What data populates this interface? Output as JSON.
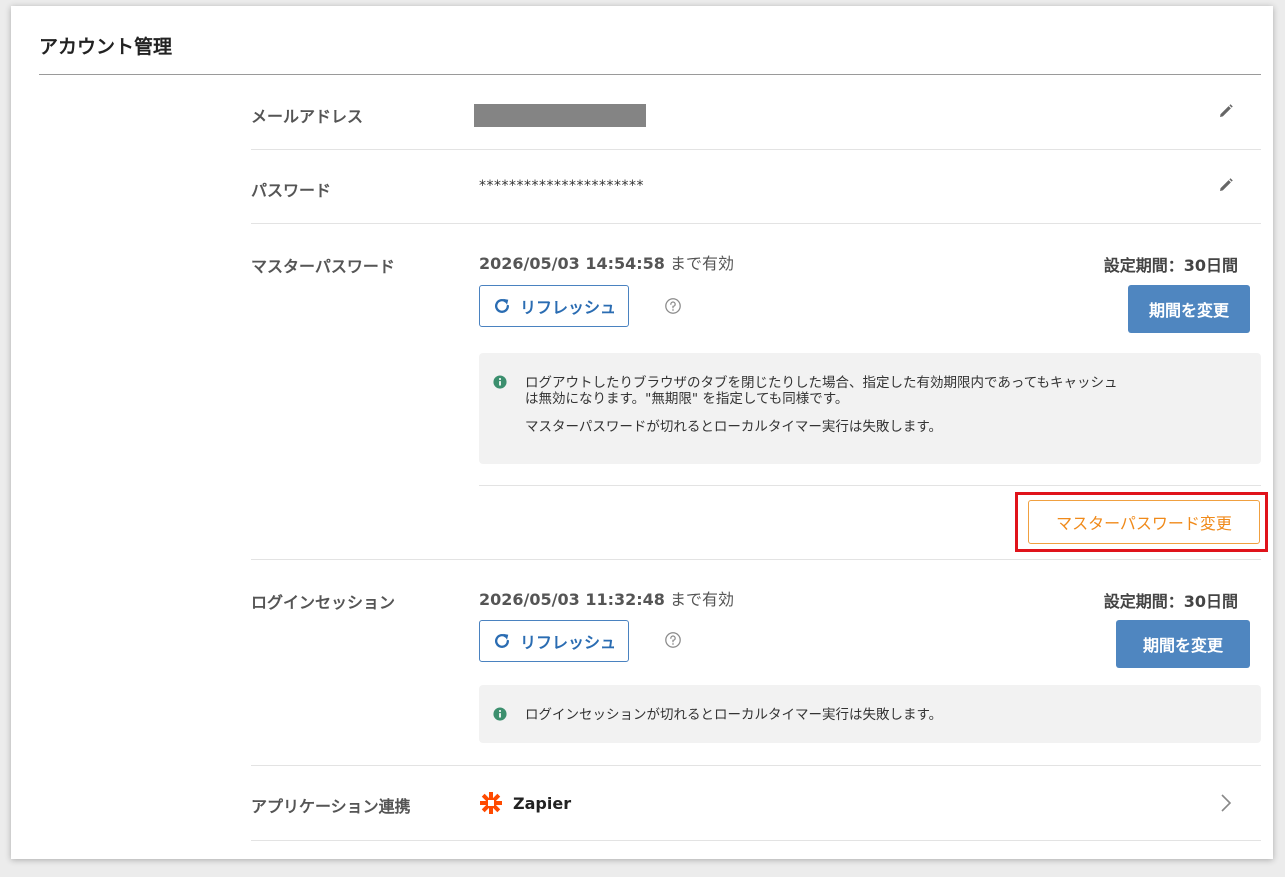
{
  "page": {
    "title": "アカウント管理"
  },
  "email": {
    "label": "メールアドレス"
  },
  "password": {
    "label": "パスワード",
    "value": "**********************"
  },
  "master_password": {
    "label": "マスターパスワード",
    "expiry_datetime": "2026/05/03 14:54:58",
    "expiry_suffix": " まで有効",
    "period": "設定期間：30日間",
    "refresh_label": "リフレッシュ",
    "change_period_label": "期間を変更",
    "info_line1": "ログアウトしたりブラウザのタブを閉じたりした場合、指定した有効期限内であってもキャッシュ",
    "info_line2": "は無効になります。\"無期限\" を指定しても同様です。",
    "info_line3": "マスターパスワードが切れるとローカルタイマー実行は失敗します。",
    "change_label": "マスターパスワード変更"
  },
  "login_session": {
    "label": "ログインセッション",
    "expiry_datetime": "2026/05/03 11:32:48",
    "expiry_suffix": " まで有効",
    "period": "設定期間：30日間",
    "refresh_label": "リフレッシュ",
    "change_period_label": "期間を変更",
    "info_line1": "ログインセッションが切れるとローカルタイマー実行は失敗します。"
  },
  "app_integration": {
    "label": "アプリケーション連携",
    "app_name": "Zapier"
  },
  "colors": {
    "primary": "#4f86c0",
    "accent_orange": "#f08a1a",
    "highlight_red": "#e0131b",
    "info_green": "#3c8f6e",
    "zapier_orange": "#ff4a00"
  },
  "icons": [
    "pencil-icon",
    "refresh-icon",
    "help-icon",
    "info-icon",
    "zapier-logo",
    "chevron-right-icon"
  ]
}
